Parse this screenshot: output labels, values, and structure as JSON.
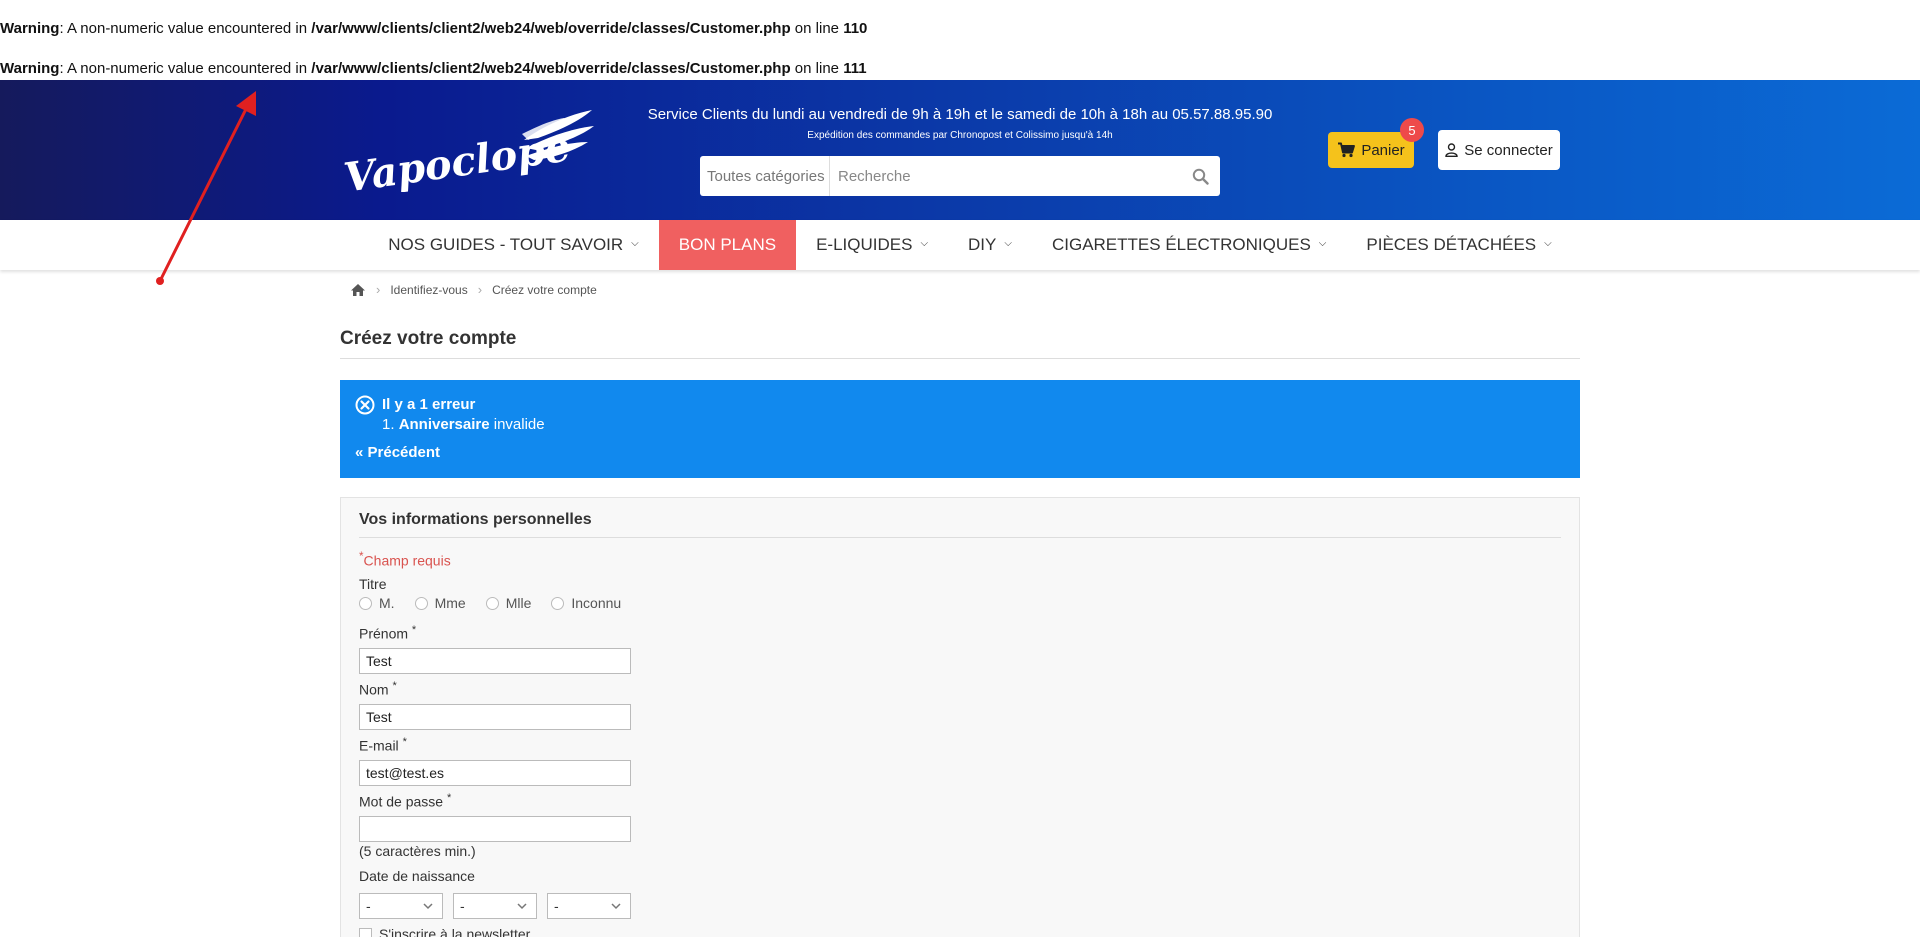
{
  "warnings": [
    {
      "label": "Warning",
      "message": ": A non-numeric value encountered in ",
      "path": "/var/www/clients/client2/web24/web/override/classes/Customer.php",
      "line_text": " on line ",
      "line": "110"
    },
    {
      "label": "Warning",
      "message": ": A non-numeric value encountered in ",
      "path": "/var/www/clients/client2/web24/web/override/classes/Customer.php",
      "line_text": " on line ",
      "line": "111"
    }
  ],
  "header": {
    "logo_text": "Vapoclope",
    "service_line": "Service Clients du lundi au vendredi de 9h à 19h et le samedi de 10h à 18h au 05.57.88.95.90",
    "shipping_line": "Expédition des commandes par Chronopost et Colissimo jusqu'à 14h",
    "search": {
      "category": "Toutes catégories",
      "placeholder": "Recherche",
      "value": ""
    },
    "cart": {
      "label": "Panier",
      "count": "5"
    },
    "login_label": "Se connecter"
  },
  "nav": {
    "items": [
      {
        "label": "NOS GUIDES - TOUT SAVOIR",
        "has_dropdown": true
      },
      {
        "label": "BON PLANS",
        "has_dropdown": false
      },
      {
        "label": "E-LIQUIDES",
        "has_dropdown": true
      },
      {
        "label": "DIY",
        "has_dropdown": true
      },
      {
        "label": "CIGARETTES ÉLECTRONIQUES",
        "has_dropdown": true
      },
      {
        "label": "PIÈCES DÉTACHÉES",
        "has_dropdown": true
      }
    ]
  },
  "breadcrumb": {
    "items": [
      "Identifiez-vous",
      "Créez votre compte"
    ]
  },
  "page_title": "Créez votre compte",
  "error": {
    "title": "Il y a 1 erreur",
    "item_number": "1.",
    "item_field": "Anniversaire",
    "item_text": " invalide",
    "back_label": "« Précédent"
  },
  "form": {
    "section_title": "Vos informations personnelles",
    "required_note": "Champ requis",
    "title_label": "Titre",
    "title_options": [
      "M.",
      "Mme",
      "Mlle",
      "Inconnu"
    ],
    "firstname": {
      "label": "Prénom",
      "value": "Test"
    },
    "lastname": {
      "label": "Nom",
      "value": "Test"
    },
    "email": {
      "label": "E-mail",
      "value": "test@test.es"
    },
    "password": {
      "label": "Mot de passe",
      "value": "",
      "hint": "(5 caractères min.)"
    },
    "birthdate": {
      "label": "Date de naissance",
      "day": "-",
      "month": "-",
      "year": "-"
    },
    "newsletter_label": "S'inscrire à la newsletter"
  },
  "colors": {
    "header_dark": "#151a5c",
    "header_light": "#0b6bd6",
    "promo": "#f06060",
    "cart": "#f5c21b",
    "badge": "#ee4a4a",
    "error_bg": "#1189ee",
    "annotation_arrow": "#e02020"
  }
}
